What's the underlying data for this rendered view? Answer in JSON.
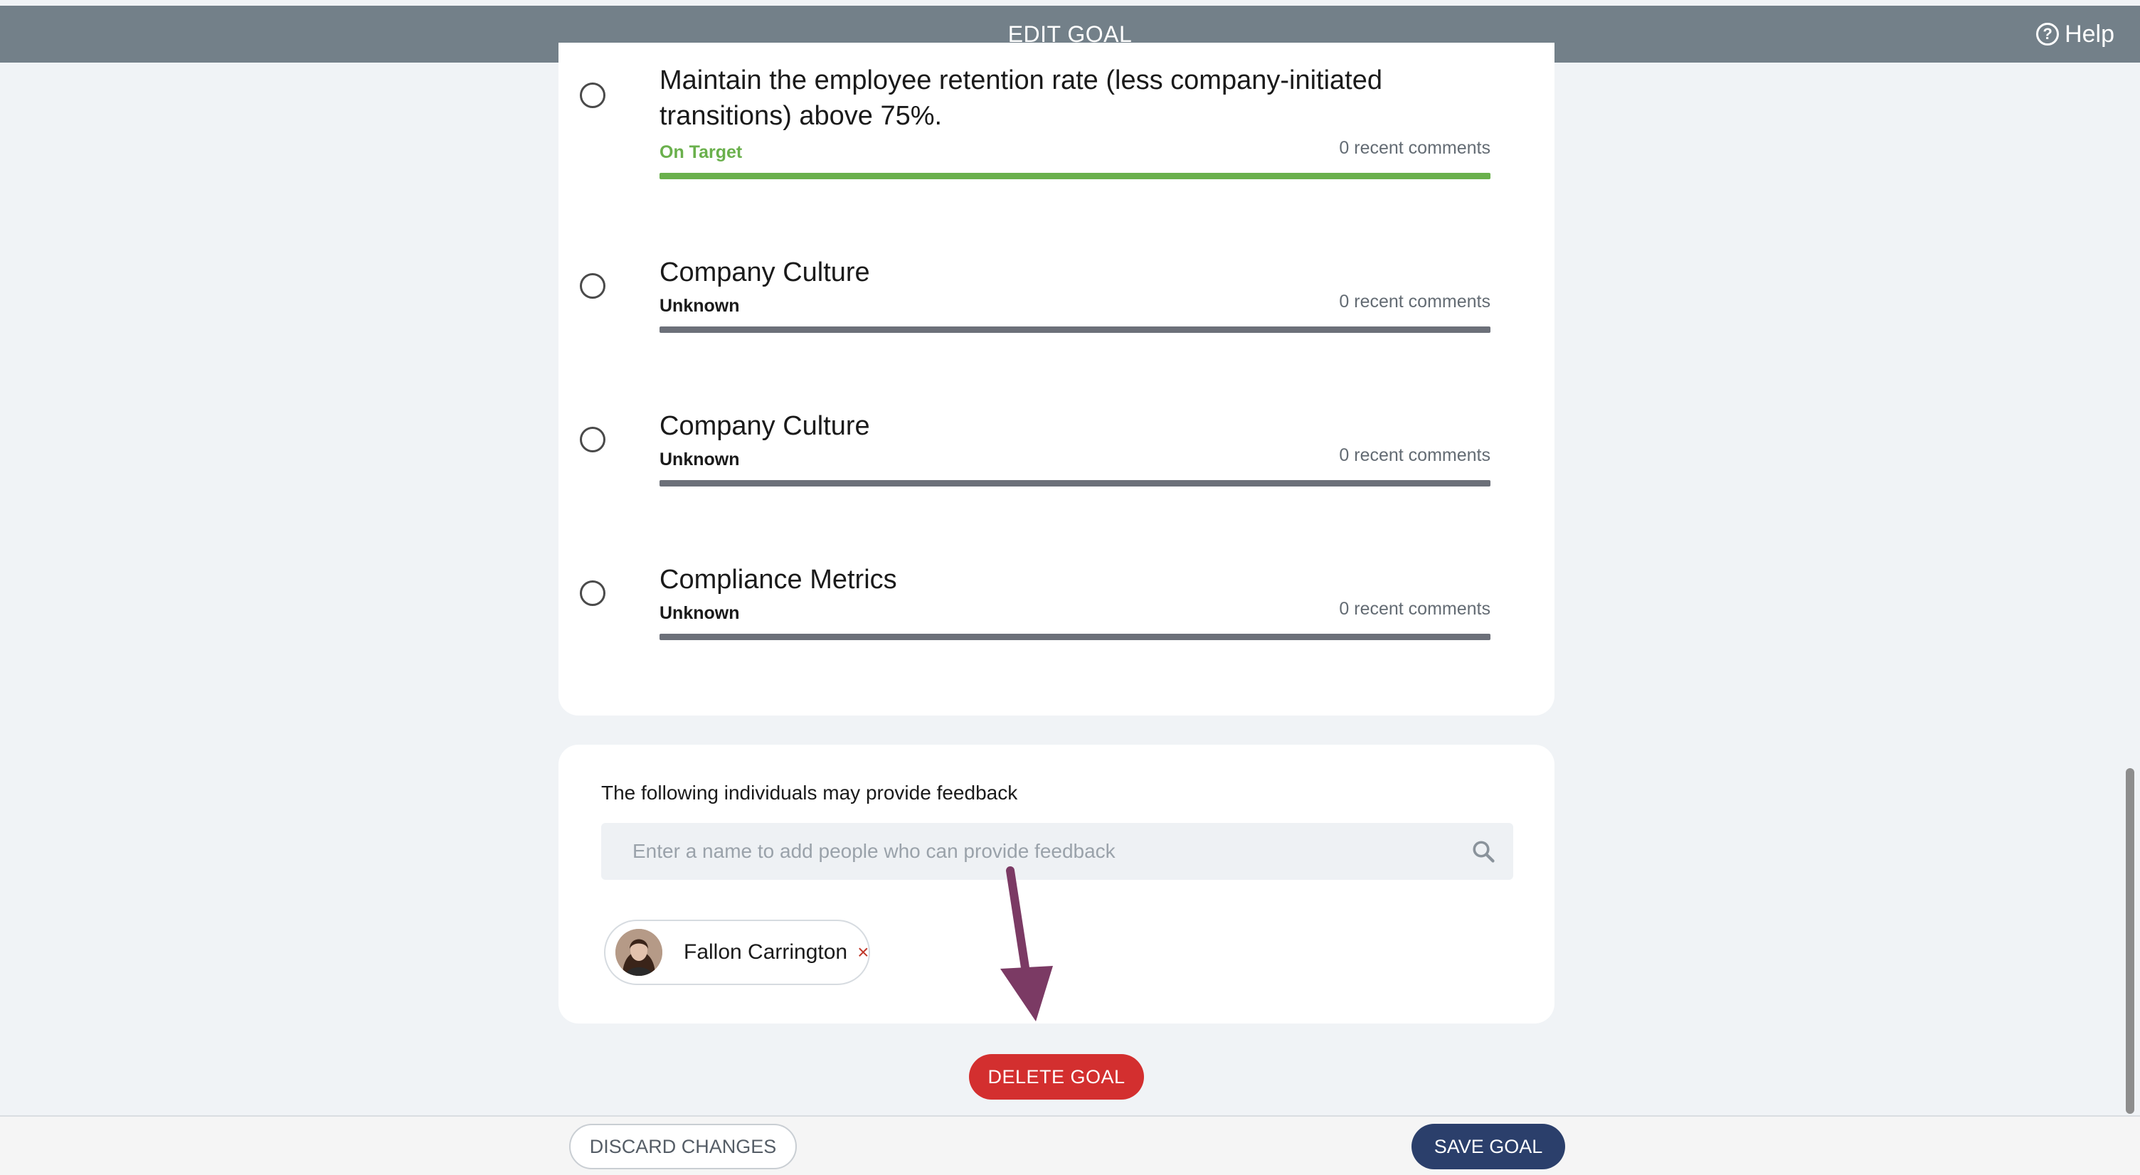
{
  "header": {
    "title": "EDIT GOAL",
    "help_label": "Help"
  },
  "goals": [
    {
      "title": "Maintain the employee retention rate (less company-initiated transitions) above 75%.",
      "status": "On Target",
      "status_color": "#6ab04c",
      "comments": "0 recent comments",
      "bar_color": "#6ab04c"
    },
    {
      "title": "Company Culture",
      "status": "Unknown",
      "status_color": "#1a1a1a",
      "comments": "0 recent comments",
      "bar_color": "#6c7079"
    },
    {
      "title": "Company Culture",
      "status": "Unknown",
      "status_color": "#1a1a1a",
      "comments": "0 recent comments",
      "bar_color": "#6c7079"
    },
    {
      "title": "Compliance Metrics",
      "status": "Unknown",
      "status_color": "#1a1a1a",
      "comments": "0 recent comments",
      "bar_color": "#6c7079"
    }
  ],
  "feedback": {
    "label": "The following individuals may provide feedback",
    "placeholder": "Enter a name to add people who can provide feedback",
    "people": [
      {
        "name": "Fallon Carrington",
        "remove_glyph": "×"
      }
    ]
  },
  "actions": {
    "delete_label": "DELETE GOAL",
    "discard_label": "DISCARD CHANGES",
    "save_label": "SAVE GOAL"
  },
  "colors": {
    "header_bg": "#738089",
    "delete_bg": "#d32f2f",
    "save_bg": "#2b3f6b",
    "annotation_arrow": "#7b3a64"
  }
}
